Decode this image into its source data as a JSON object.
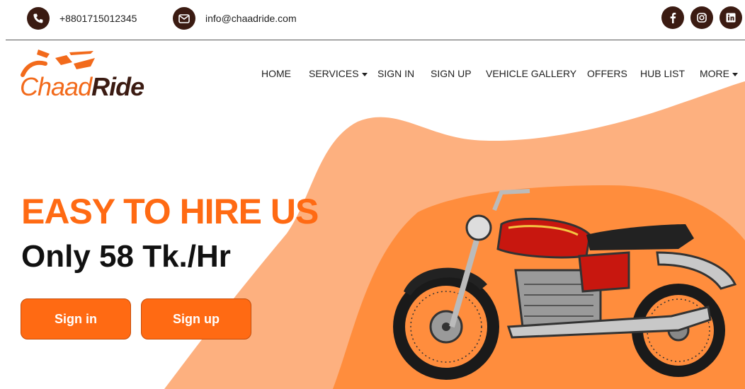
{
  "topbar": {
    "phone": "+8801715012345",
    "email": "info@chaadride.com",
    "icons": {
      "phone": "phone-icon",
      "email": "envelope-icon",
      "facebook": "facebook-icon",
      "instagram": "instagram-icon",
      "linkedin": "linkedin-icon"
    }
  },
  "brand": {
    "part1": "Chaad",
    "part2": "Ride"
  },
  "nav": {
    "home": "HOME",
    "services": "SERVICES",
    "signin": "SIGN IN",
    "signup": "SIGN UP",
    "gallery": "VEHICLE GALLERY",
    "offers": "OFFERS",
    "hublist": "HUB LIST",
    "more": "MORE"
  },
  "hero": {
    "headline": "EASY TO HIRE US",
    "price": "Only 58 Tk./Hr",
    "signin_button": "Sign in",
    "signup_button": "Sign up"
  },
  "colors": {
    "accent": "#ff6a13",
    "dark_brown": "#3b1b12",
    "light_orange": "#fdb07f",
    "mid_orange": "#ff8d3d"
  }
}
